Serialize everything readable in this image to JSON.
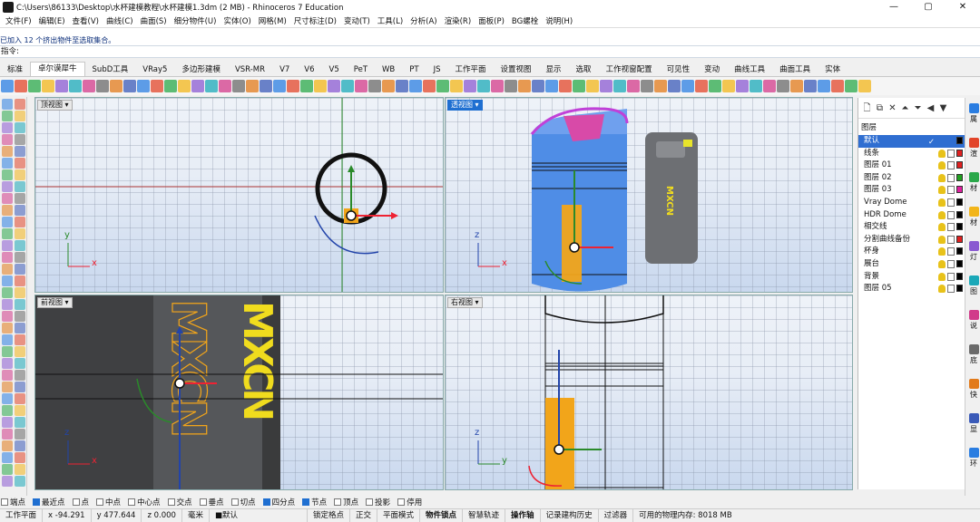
{
  "window": {
    "title": "C:\\Users\\86133\\Desktop\\水杯建模教程\\水杯建模1.3dm (2 MB) - Rhinoceros 7 Education",
    "minimize": "—",
    "maximize": "▢",
    "close": "✕"
  },
  "menu": [
    "文件(F)",
    "编辑(E)",
    "查看(V)",
    "曲线(C)",
    "曲面(S)",
    "细分物件(U)",
    "实体(O)",
    "网格(M)",
    "尺寸标注(D)",
    "变动(T)",
    "工具(L)",
    "分析(A)",
    "渲染(R)",
    "面板(P)",
    "BG螺栓",
    "说明(H)"
  ],
  "command": {
    "history": "已加入 12 个挤出物件至选取集合。",
    "prompt": "指令:"
  },
  "tabs": [
    "标准",
    "卓尔谟犀牛",
    "SubD工具",
    "VRay5",
    "多边形建模",
    "VSR-MR",
    "V7",
    "V6",
    "V5",
    "PeT",
    "WB",
    "PT",
    "JS",
    "工作平面",
    "设置视图",
    "显示",
    "选取",
    "工作视窗配置",
    "可见性",
    "变动",
    "曲线工具",
    "曲面工具",
    "实体"
  ],
  "viewports": {
    "top": "顶视图",
    "perspective": "透视图",
    "front": "前视图",
    "right": "右视图"
  },
  "axes": {
    "x": "x",
    "y": "y",
    "z": "z"
  },
  "layers_panel": {
    "title": "图层",
    "tools": [
      "🗋",
      "⧉",
      "✕",
      "⏶",
      "⏷",
      "◀",
      "▼"
    ],
    "layers": [
      {
        "name": "默认",
        "selected": true,
        "color": "#000000",
        "current": "✓"
      },
      {
        "name": "线条",
        "selected": false,
        "color": "#e02020"
      },
      {
        "name": "图层 01",
        "selected": false,
        "color": "#e02020"
      },
      {
        "name": "图层 02",
        "selected": false,
        "color": "#20a020"
      },
      {
        "name": "图层 03",
        "selected": false,
        "color": "#e020a0"
      },
      {
        "name": "Vray Dome",
        "selected": false,
        "color": "#000000"
      },
      {
        "name": "HDR Dome",
        "selected": false,
        "color": "#000000"
      },
      {
        "name": "相交线",
        "selected": false,
        "color": "#000000"
      },
      {
        "name": "分割曲线备份",
        "selected": false,
        "color": "#e02020"
      },
      {
        "name": "杯身",
        "selected": false,
        "color": "#000000"
      },
      {
        "name": "展台",
        "selected": false,
        "color": "#000000"
      },
      {
        "name": "背景",
        "selected": false,
        "color": "#000000"
      },
      {
        "name": "图层 05",
        "selected": false,
        "color": "#000000"
      }
    ]
  },
  "right_rail": [
    "属",
    "渲",
    "材",
    "材",
    "灯",
    "图",
    "说",
    "底",
    "快",
    "显",
    "环"
  ],
  "osnaps": [
    {
      "label": "端点",
      "on": false
    },
    {
      "label": "最近点",
      "on": true
    },
    {
      "label": "点",
      "on": false
    },
    {
      "label": "中点",
      "on": false
    },
    {
      "label": "中心点",
      "on": false
    },
    {
      "label": "交点",
      "on": false
    },
    {
      "label": "垂点",
      "on": false
    },
    {
      "label": "切点",
      "on": false
    },
    {
      "label": "四分点",
      "on": true
    },
    {
      "label": "节点",
      "on": true
    },
    {
      "label": "顶点",
      "on": false
    },
    {
      "label": "投影",
      "on": false
    },
    {
      "label": "停用",
      "on": false
    }
  ],
  "status": {
    "plane": "工作平面",
    "x": "x -94.291",
    "y": "y 477.644",
    "z": "z 0.000",
    "units": "毫米",
    "layer": "■默认",
    "toggles": [
      "锁定格点",
      "正交",
      "平面模式",
      "物件锁点",
      "智慧轨迹",
      "操作轴",
      "记录建构历史",
      "过滤器"
    ],
    "memory": "可用的物理内存: 8018 MB"
  },
  "scene_text": "MXCN",
  "colors": {
    "accent": "#1f6fd1",
    "bottle": "#4f8de6",
    "logo": "#f2a51a",
    "yellow_print": "#f0dc1e"
  }
}
